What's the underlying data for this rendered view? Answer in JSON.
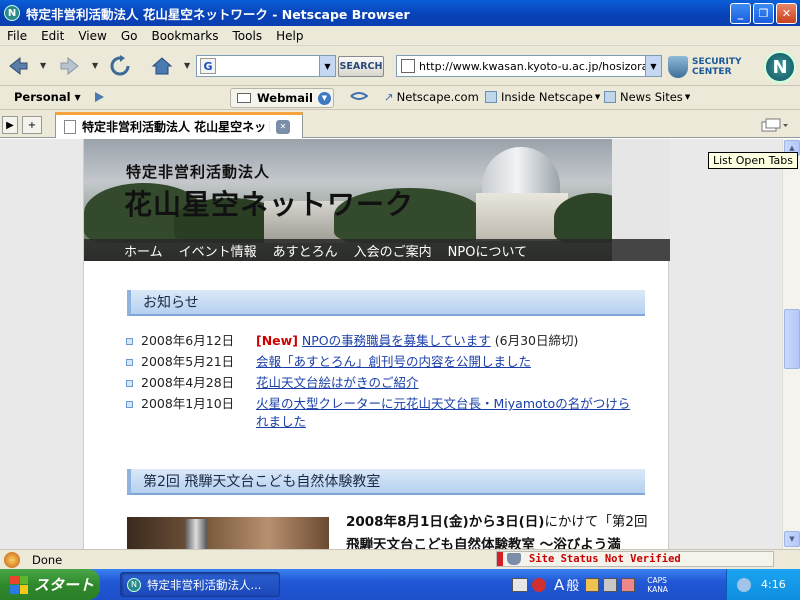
{
  "window": {
    "title": "特定非営利活動法人 花山星空ネットワーク - Netscape Browser",
    "minimize": "_",
    "maximize": "❐",
    "close": "✕"
  },
  "menu": [
    "File",
    "Edit",
    "View",
    "Go",
    "Bookmarks",
    "Tools",
    "Help"
  ],
  "toolbar": {
    "back_icon": "back-arrow-icon",
    "forward_icon": "forward-arrow-icon",
    "reload_icon": "reload-icon",
    "home_icon": "home-icon",
    "search_engine_letter": "G",
    "search_value": "",
    "search_button": "SEARCH",
    "url": "http://www.kwasan.kyoto-u.ac.jp/hosizora/",
    "security_line1": "SECURITY",
    "security_line2": "CENTER",
    "logo_letter": "N"
  },
  "personal_bar": {
    "personal_label": "Personal",
    "webmail_label": "Webmail",
    "links": [
      "Netscape.com",
      "Inside Netscape",
      "News Sites"
    ]
  },
  "tabs": [
    {
      "label": "特定非営利活動法人 花山星空ネットワーク"
    }
  ],
  "tab_new": "+",
  "tooltip": "List Open Tabs",
  "page": {
    "org_type": "特定非営利活動法人",
    "site_title": "花山星空ネットワーク",
    "nav": [
      "ホーム",
      "イベント情報",
      "あすとろん",
      "入会のご案内",
      "NPOについて"
    ],
    "news_heading": "お知らせ",
    "news": [
      {
        "date": "2008年6月12日",
        "badge": "[New]",
        "link": "NPOの事務職員を募集しています",
        "note": "(6月30日締切)"
      },
      {
        "date": "2008年5月21日",
        "badge": "",
        "link": "会報「あすとろん」創刊号の内容を公開しました",
        "note": ""
      },
      {
        "date": "2008年4月28日",
        "badge": "",
        "link": "花山天文台絵はがきのご紹介",
        "note": ""
      },
      {
        "date": "2008年1月10日",
        "badge": "",
        "link": "火星の大型クレーターに元花山天文台長・Miyamotoの名がつけられました",
        "note": ""
      }
    ],
    "event_heading": "第2回 飛騨天文台こども自然体験教室",
    "event_line1_bold": "2008年8月1日(金)から3日(日)",
    "event_line1_rest": "にかけて「第2回",
    "event_line2": "飛騨天文台こども自然体験教室 ～浴びよう満"
  },
  "status": {
    "text": "Done",
    "site_status": "Site Status Not Verified"
  },
  "taskbar": {
    "start_label": "スタート",
    "task_label": "特定非営利活動法人...",
    "ime_char1": "A",
    "ime_char2": "般",
    "caps": "CAPS",
    "kana": "KANA",
    "clock": "4:16"
  }
}
